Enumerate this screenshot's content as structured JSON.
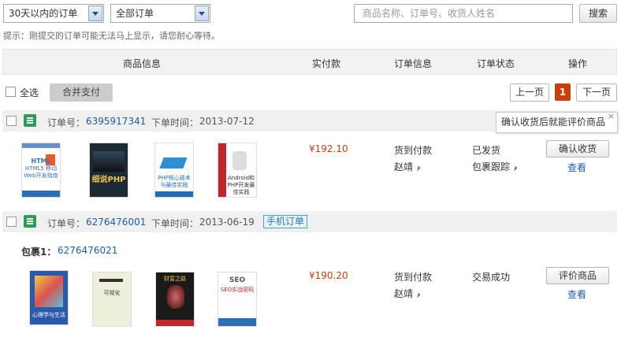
{
  "filters": {
    "period": "30天以内的订单",
    "status": "全部订单",
    "search_placeholder": "商品名称、订单号、收货人姓名",
    "search_btn": "搜索",
    "tip": "提示：刚提交的订单可能无法马上显示，请您耐心等待。"
  },
  "columns": [
    "商品信息",
    "实付款",
    "订单信息",
    "订单状态",
    "操作"
  ],
  "toolbar": {
    "select_all": "全选",
    "merge_pay": "合并支付",
    "prev": "上一页",
    "current_page": "1",
    "next": "下一页"
  },
  "tooltip": "确认收货后就能评价商品",
  "orders": [
    {
      "order_no_label": "订单号：",
      "order_no": "6395917341",
      "time_label": "下单时间：",
      "time": "2013-07-12",
      "books": [
        "HTML5 移动Web开发指南",
        "细说PHP",
        "PHP核心技术与最佳实践",
        "Android和PHP开发最佳实践"
      ],
      "price": "¥192.10",
      "pay_method": "货到付款",
      "recipient": "赵靖",
      "status": "已发货",
      "track": "包裹跟踪",
      "action": "确认收货",
      "view": "查看"
    },
    {
      "order_no_label": "订单号：",
      "order_no": "6276476001",
      "time_label": "下单时间：",
      "time": "2013-06-19",
      "mobile_tag": "手机订单",
      "package_label": "包裹1：",
      "package_no": "6276476021",
      "books": [
        "心理学与生活",
        "可视化",
        "财富之路",
        "SEO实战密码"
      ],
      "price": "¥190.20",
      "pay_method": "货到付款",
      "recipient": "赵靖",
      "status": "交易成功",
      "action": "评价商品",
      "view": "查看"
    }
  ]
}
